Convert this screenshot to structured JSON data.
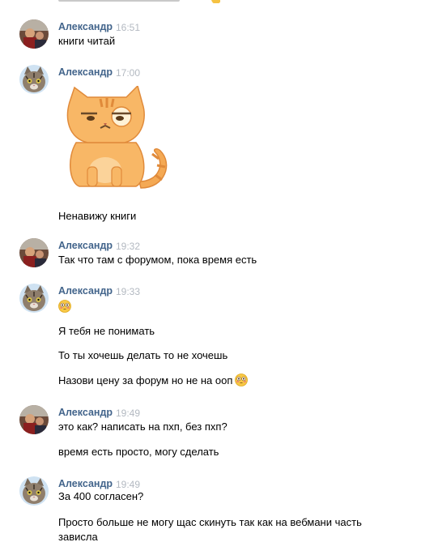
{
  "messages": [
    {
      "author": "Александр",
      "avatar": "avatar-photo-icon",
      "time": "16:51",
      "lines": [
        "книги читай"
      ]
    },
    {
      "author": "Александр",
      "avatar": "avatar-cat-icon",
      "time": "17:00",
      "sticker": "sticker-grumpy-cat",
      "lines": [
        "Ненавижу книги"
      ]
    },
    {
      "author": "Александр",
      "avatar": "avatar-photo-icon",
      "time": "19:32",
      "lines": [
        "Так что там с форумом, пока время есть"
      ]
    },
    {
      "author": "Александр",
      "avatar": "avatar-cat-icon",
      "time": "19:33",
      "emoji": "flushed-emoji-icon",
      "lines": [
        "Я тебя не понимать",
        "То ты хочешь делать то не хочешь",
        "Назови цену за форум но не на ооп"
      ]
    },
    {
      "author": "Александр",
      "avatar": "avatar-photo-icon",
      "time": "19:49",
      "lines": [
        "это как? написать на пхп, без пхп?",
        "время есть просто, могу сделать"
      ]
    },
    {
      "author": "Александр",
      "avatar": "avatar-cat-icon",
      "time": "19:49",
      "lines": [
        "За 400 согласен?",
        "Просто больше не могу щас скинуть так как на вебмани часть",
        "зависла"
      ]
    }
  ],
  "colors": {
    "author": "#42648b",
    "time": "#b3b9c1",
    "text": "#000000"
  }
}
